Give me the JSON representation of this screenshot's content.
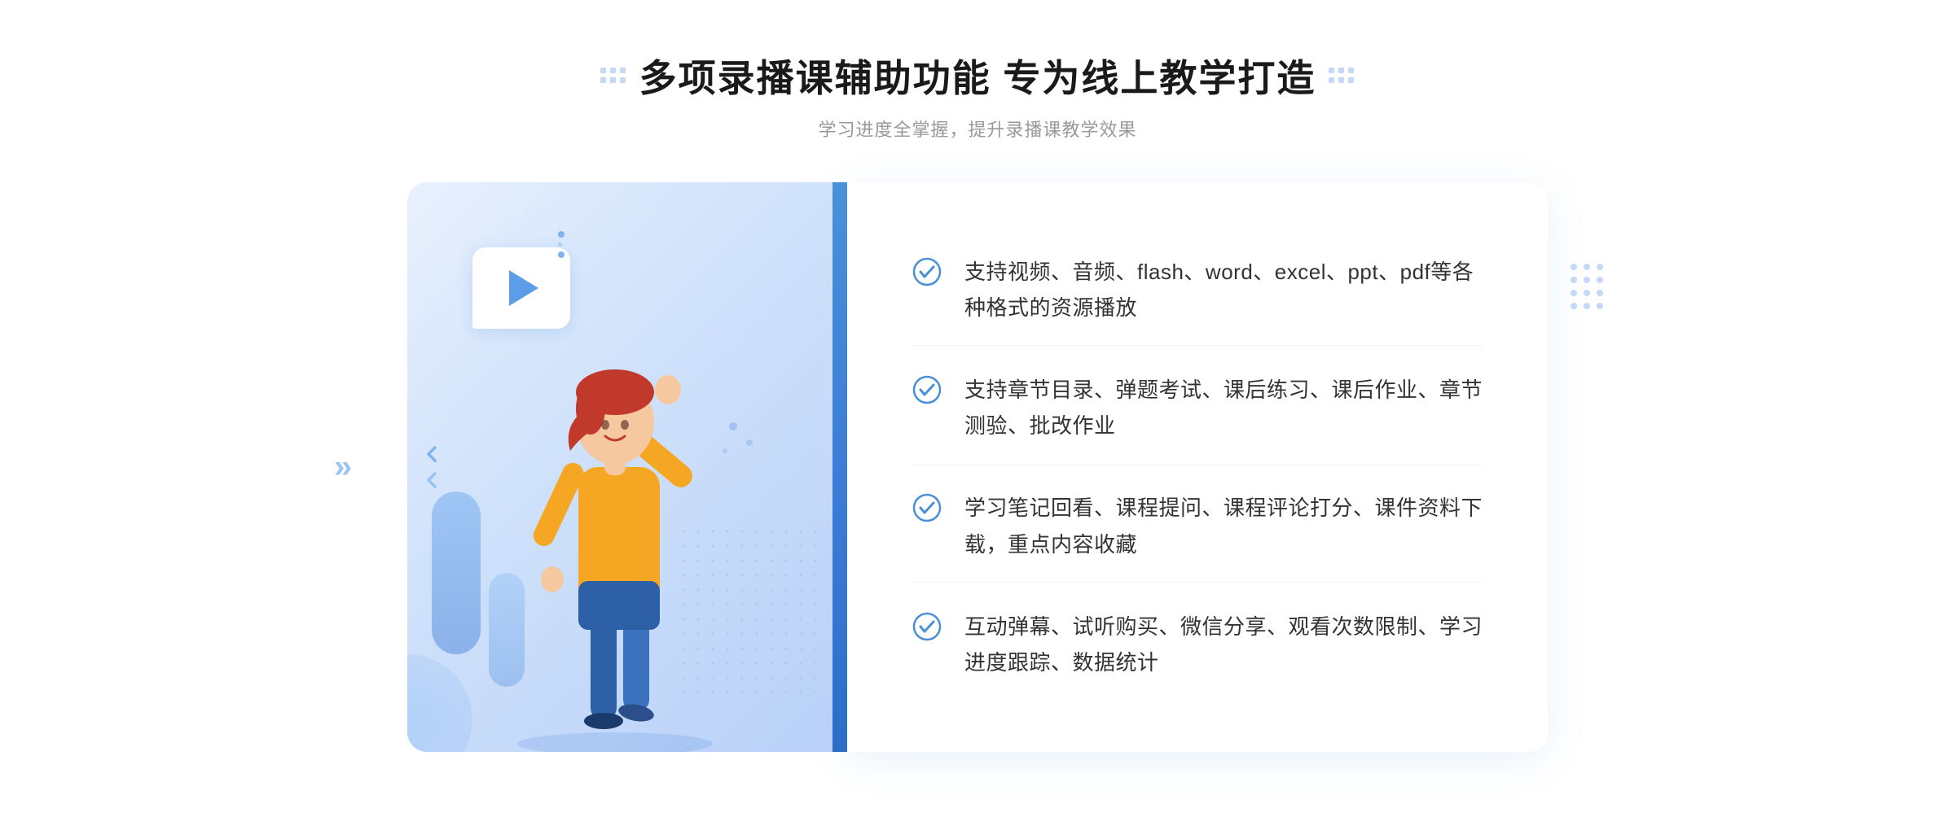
{
  "header": {
    "main_title": "多项录播课辅助功能 专为线上教学打造",
    "subtitle": "学习进度全掌握，提升录播课教学效果"
  },
  "features": [
    {
      "id": 1,
      "text": "支持视频、音频、flash、word、excel、ppt、pdf等各种格式的资源播放"
    },
    {
      "id": 2,
      "text": "支持章节目录、弹题考试、课后练习、课后作业、章节测验、批改作业"
    },
    {
      "id": 3,
      "text": "学习笔记回看、课程提问、课程评论打分、课件资料下载，重点内容收藏"
    },
    {
      "id": 4,
      "text": "互动弹幕、试听购买、微信分享、观看次数限制、学习进度跟踪、数据统计"
    }
  ],
  "colors": {
    "accent_blue": "#4a90d9",
    "light_blue": "#e8f0fd",
    "text_dark": "#1a1a1a",
    "text_sub": "#999999",
    "check_color": "#4a90d9"
  }
}
